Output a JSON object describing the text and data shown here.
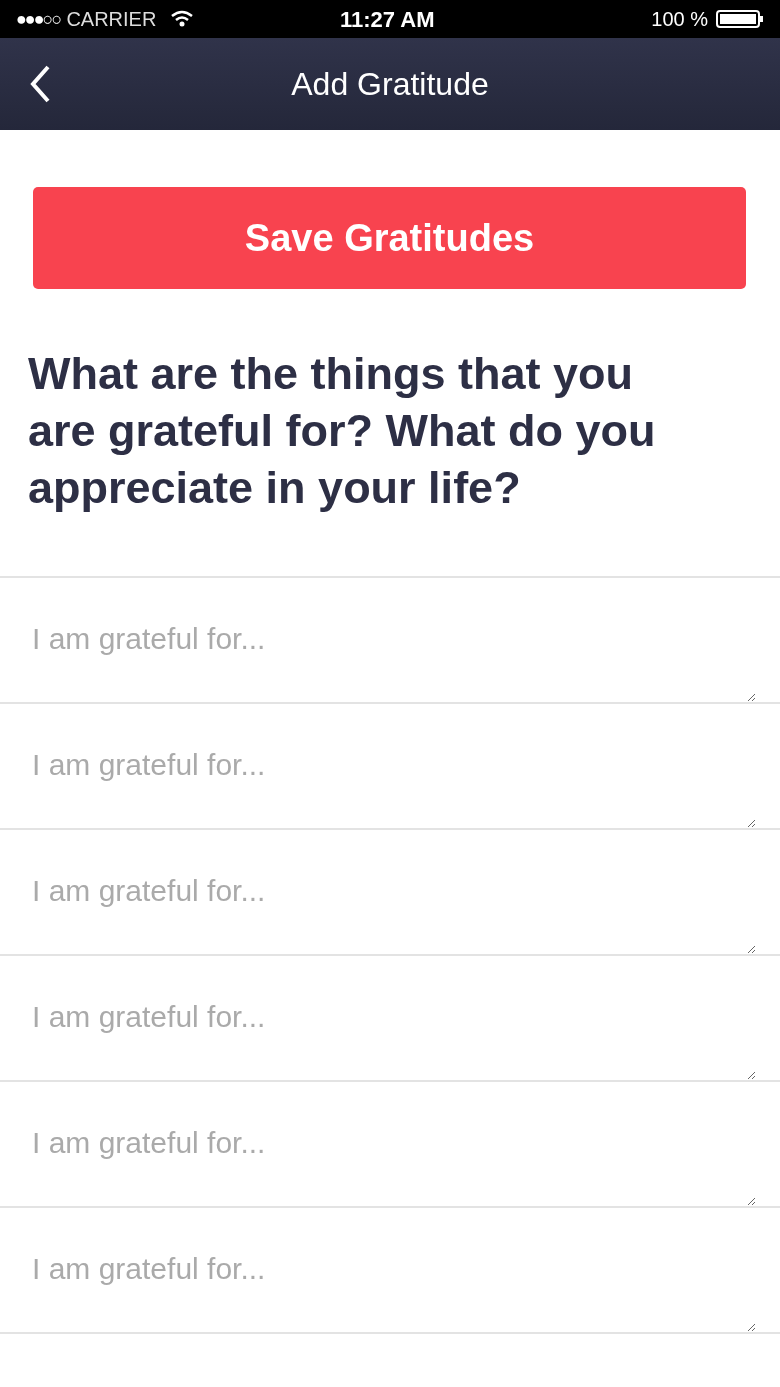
{
  "status_bar": {
    "signal": "●●●○○",
    "carrier": "CARRIER",
    "time": "11:27 AM",
    "battery": "100 %"
  },
  "nav": {
    "title": "Add Gratitude"
  },
  "save_button": "Save Gratitudes",
  "prompt": "What are the things that you are grateful for? What do you appreciate in your life?",
  "fields": [
    {
      "placeholder": "I am grateful for..."
    },
    {
      "placeholder": "I am grateful for..."
    },
    {
      "placeholder": "I am grateful for..."
    },
    {
      "placeholder": "I am grateful for..."
    },
    {
      "placeholder": "I am grateful for..."
    },
    {
      "placeholder": "I am grateful for..."
    }
  ]
}
